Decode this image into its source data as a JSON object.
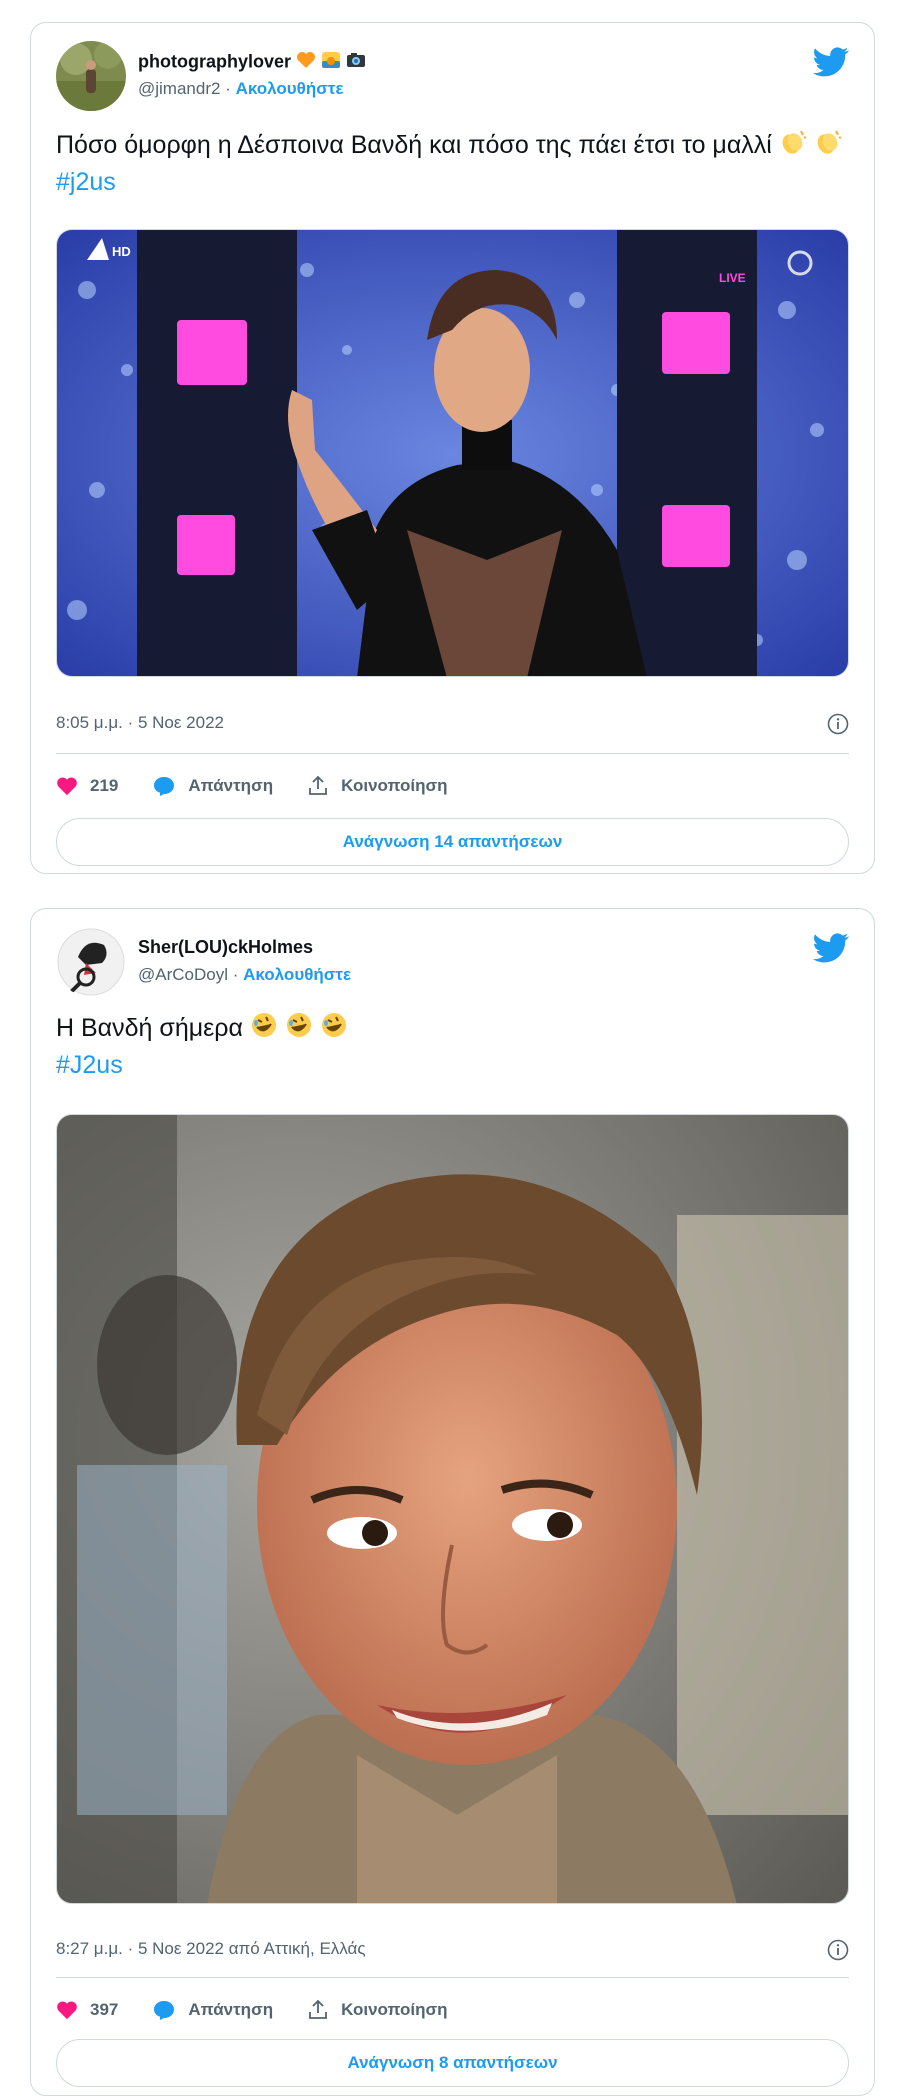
{
  "tweets": [
    {
      "display_name": "photographylover",
      "handle": "@jimandr2",
      "separator": " · ",
      "follow_label": "Ακολουθήστε",
      "text_main": "Πόσο όμορφη η Δέσποινα Βανδή και πόσο της πάει έτσι το μαλλί",
      "hashtag": "#j2us",
      "media_badge_channel": "HD",
      "media_badge_live": "LIVE",
      "timestamp": "8:05 μ.μ. · 5 Νοε 2022",
      "likes": "219",
      "reply_label": "Απάντηση",
      "share_label": "Κοινοποίηση",
      "read_replies_label": "Ανάγνωση 14 απαντήσεων"
    },
    {
      "display_name": "Sher(LOU)ckHolmes",
      "handle": "@ArCoDoyl",
      "separator": " · ",
      "follow_label": "Ακολουθήστε",
      "text_main": "Η Βανδή σήμερα",
      "hashtag": "#J2us",
      "timestamp": "8:27 μ.μ. · 5 Νοε 2022 από Αττική, Ελλάς",
      "likes": "397",
      "reply_label": "Απάντηση",
      "share_label": "Κοινοποίηση",
      "read_replies_label": "Ανάγνωση 8 απαντήσεων"
    }
  ],
  "colors": {
    "accent": "#1d9bf0",
    "like": "#f91880",
    "text": "#0f1419",
    "muted": "#536471",
    "border": "#cfd9de"
  },
  "icons": [
    "twitter-bird-icon",
    "heart-icon",
    "reply-bubble-icon",
    "share-icon",
    "info-icon",
    "clap-emoji",
    "rofl-emoji"
  ]
}
